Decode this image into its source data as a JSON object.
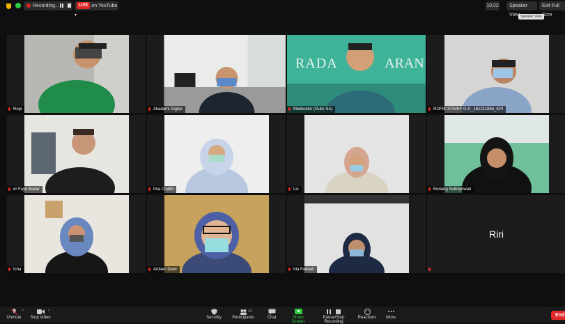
{
  "topbar": {
    "recording_label": "Recording...",
    "live_badge": "LIVE",
    "live_label": "on YouTube",
    "clock": "10:22",
    "speaker_view": "Speaker View",
    "exit_full_screen": "Exit Full Scre",
    "tooltip": "Speaker View"
  },
  "participants": [
    {
      "name": "Ropi"
    },
    {
      "name": "Akademi Digital"
    },
    {
      "name": "Moderator (Gulis SA)"
    },
    {
      "name": "ROFIK SYARIF G.P._161211065_KPI"
    },
    {
      "name": "dr Fayd Badar"
    },
    {
      "name": "Ima Chafid"
    },
    {
      "name": "Lis"
    },
    {
      "name": "Endang Sulistyowati"
    },
    {
      "name": "Icha"
    },
    {
      "name": "Ardiani Dewi"
    },
    {
      "name": "Ida Fadilah"
    },
    {
      "name": "",
      "display_name": "Riri"
    }
  ],
  "banner_text": "RADA",
  "banner_text2": "ARAN",
  "toolbar": {
    "unmute": "Unmute",
    "stop_video": "Stop Video",
    "security": "Security",
    "participants": "Participants",
    "participants_count": "12",
    "chat": "Chat",
    "share_screen": "Share Screen",
    "recording": "Pause/Stop Recording",
    "reactions": "Reactions",
    "more": "More",
    "end": "End"
  },
  "colors": {
    "active_border": "#8fd14f",
    "share_green": "#2ecc40",
    "live_red": "#e02828"
  }
}
